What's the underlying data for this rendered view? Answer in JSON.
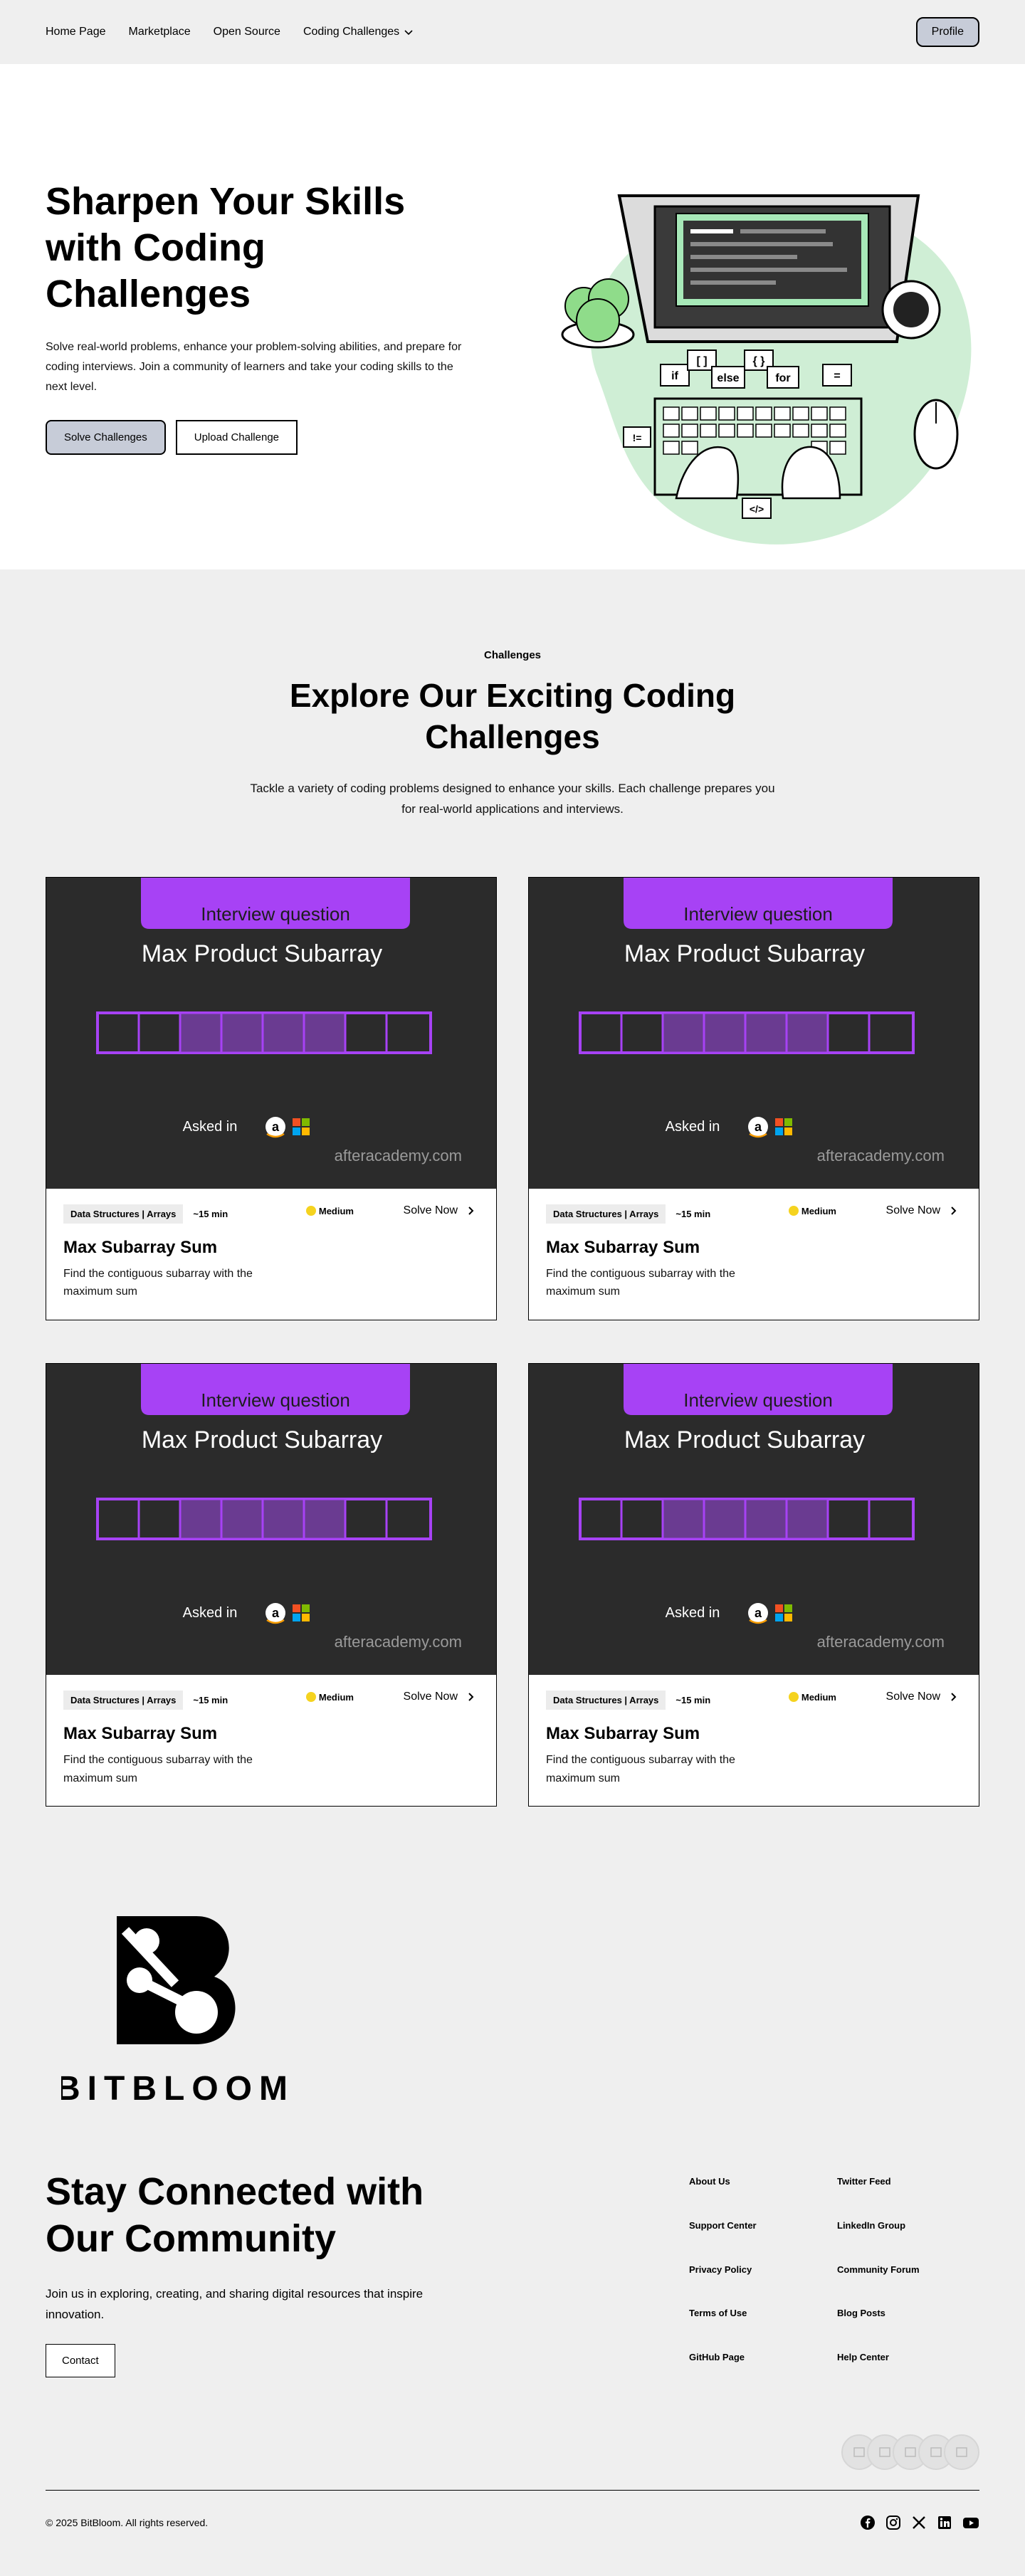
{
  "nav": {
    "links": [
      "Home Page",
      "Marketplace",
      "Open Source",
      "Coding Challenges"
    ],
    "profile_label": "Profile"
  },
  "hero": {
    "title": "Sharpen Your Skills with Coding Challenges",
    "text": "Solve real-world problems, enhance your problem-solving abilities, and prepare for coding interviews. Join a community of learners and take your coding skills to the next level.",
    "primary_button": "Solve Challenges",
    "secondary_button": "Upload Challenge",
    "illustration_bubbles": [
      "if",
      "[ ]",
      "else",
      "{ }",
      "for",
      "=",
      "!=",
      "</>"
    ]
  },
  "challenges": {
    "eyebrow": "Challenges",
    "title": "Explore Our Exciting Coding Challenges",
    "text": "Tackle a variety of coding problems designed to enhance your skills. Each challenge prepares you for real-world applications and interviews.",
    "cards": [
      {
        "banner": "Interview question",
        "image_title": "Max Product Subarray",
        "asked_in": "Asked in",
        "site": "afteracademy.com",
        "tag": "Data Structures | Arrays",
        "time": "~15 min",
        "difficulty": "Medium",
        "solve_label": "Solve Now",
        "title": "Max Subarray Sum",
        "description": "Find the contiguous subarray with the maximum sum"
      },
      {
        "banner": "Interview question",
        "image_title": "Max Product Subarray",
        "asked_in": "Asked in",
        "site": "afteracademy.com",
        "tag": "Data Structures | Arrays",
        "time": "~15 min",
        "difficulty": "Medium",
        "solve_label": "Solve Now",
        "title": "Max Subarray Sum",
        "description": "Find the contiguous subarray with the maximum sum"
      },
      {
        "banner": "Interview question",
        "image_title": "Max Product Subarray",
        "asked_in": "Asked in",
        "site": "afteracademy.com",
        "tag": "Data Structures | Arrays",
        "time": "~15 min",
        "difficulty": "Medium",
        "solve_label": "Solve Now",
        "title": "Max Subarray Sum",
        "description": "Find the contiguous subarray with the maximum sum"
      },
      {
        "banner": "Interview question",
        "image_title": "Max Product Subarray",
        "asked_in": "Asked in",
        "site": "afteracademy.com",
        "tag": "Data Structures | Arrays",
        "time": "~15 min",
        "difficulty": "Medium",
        "solve_label": "Solve Now",
        "title": "Max Subarray Sum",
        "description": "Find the contiguous subarray with the maximum sum"
      }
    ]
  },
  "footer": {
    "brand": "BITBLOOM",
    "title": "Stay Connected with Our Community",
    "text": "Join us in exploring, creating, and sharing digital resources that inspire innovation.",
    "contact_label": "Contact",
    "links_col1": [
      "About Us",
      "Support Center",
      "Privacy Policy",
      "Terms of Use",
      "GitHub Page"
    ],
    "links_col2": [
      "Twitter Feed",
      "LinkedIn Group",
      "Community Forum",
      "Blog Posts",
      "Help Center"
    ],
    "copyright": "© 2025 BitBloom. All rights reserved.",
    "socials": [
      "facebook-icon",
      "instagram-icon",
      "x-icon",
      "linkedin-icon",
      "youtube-icon"
    ]
  },
  "colors": {
    "accent_purple": "#a742f5",
    "button_gray": "#c7ccd8",
    "illustration_green": "#cfeed5",
    "card_dark": "#2b2b2b",
    "medium_dot": "#f5d31f"
  }
}
